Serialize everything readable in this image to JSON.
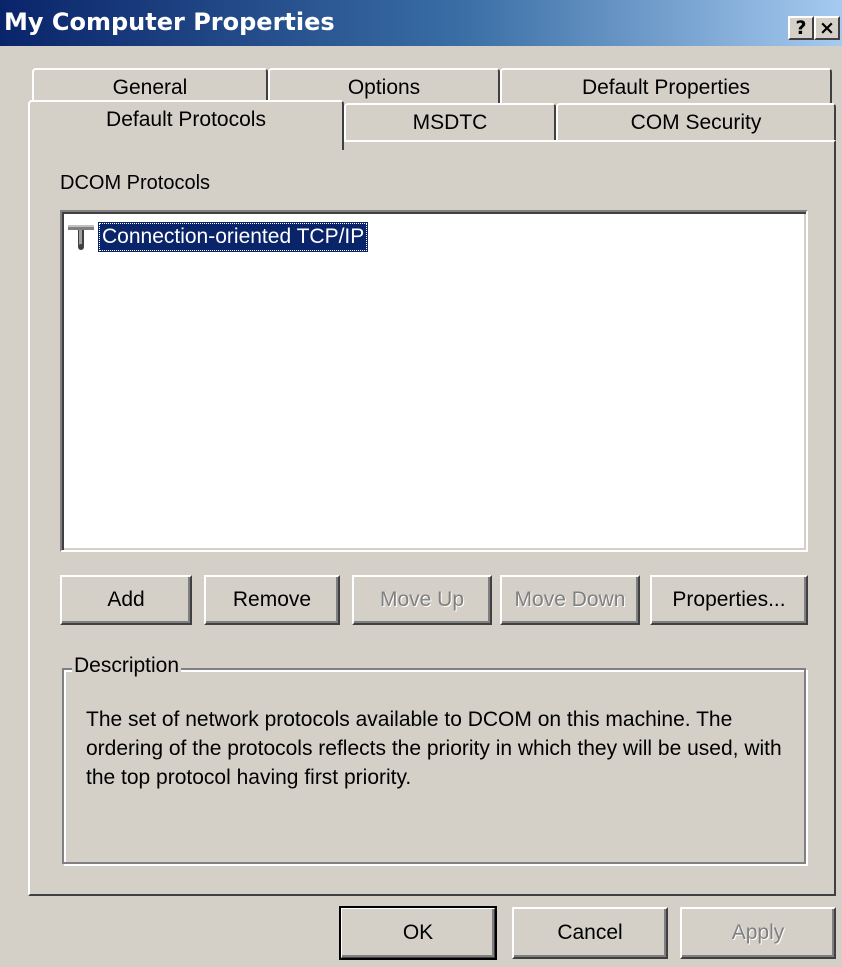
{
  "window": {
    "title": "My Computer Properties",
    "help_button": "?",
    "close_button": "×"
  },
  "tabs": {
    "row1": [
      {
        "label": "General"
      },
      {
        "label": "Options"
      },
      {
        "label": "Default Properties"
      }
    ],
    "row2": [
      {
        "label": "Default Protocols",
        "active": true
      },
      {
        "label": "MSDTC"
      },
      {
        "label": "COM Security"
      }
    ]
  },
  "protocols": {
    "label": "DCOM Protocols",
    "items": [
      {
        "label": "Connection-oriented TCP/IP",
        "selected": true,
        "icon": "network-protocol-icon"
      }
    ]
  },
  "buttons": {
    "add": "Add",
    "remove": "Remove",
    "move_up": "Move Up",
    "move_down": "Move Down",
    "properties": "Properties..."
  },
  "description": {
    "title": "Description",
    "text": "The set of network protocols available to DCOM on this machine. The ordering of the protocols reflects the priority in which they will be used, with the top protocol having first priority."
  },
  "footer": {
    "ok": "OK",
    "cancel": "Cancel",
    "apply": "Apply"
  },
  "colors": {
    "titlebar_start": "#0a246a",
    "titlebar_end": "#a6caf0",
    "selection": "#0a246a",
    "face": "#d4d0c8"
  }
}
